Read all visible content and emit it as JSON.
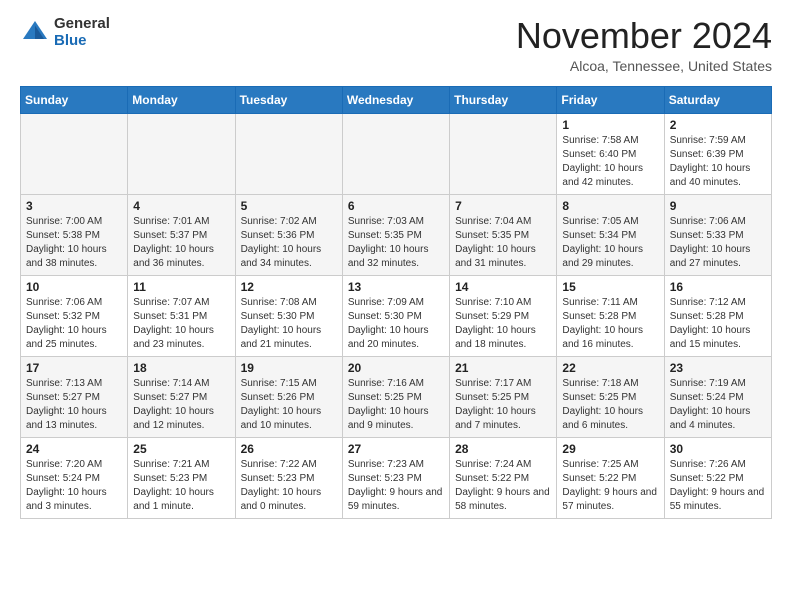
{
  "header": {
    "logo_general": "General",
    "logo_blue": "Blue",
    "month_title": "November 2024",
    "location": "Alcoa, Tennessee, United States"
  },
  "calendar": {
    "days_of_week": [
      "Sunday",
      "Monday",
      "Tuesday",
      "Wednesday",
      "Thursday",
      "Friday",
      "Saturday"
    ],
    "weeks": [
      [
        {
          "day": "",
          "info": ""
        },
        {
          "day": "",
          "info": ""
        },
        {
          "day": "",
          "info": ""
        },
        {
          "day": "",
          "info": ""
        },
        {
          "day": "",
          "info": ""
        },
        {
          "day": "1",
          "info": "Sunrise: 7:58 AM\nSunset: 6:40 PM\nDaylight: 10 hours and 42 minutes."
        },
        {
          "day": "2",
          "info": "Sunrise: 7:59 AM\nSunset: 6:39 PM\nDaylight: 10 hours and 40 minutes."
        }
      ],
      [
        {
          "day": "3",
          "info": "Sunrise: 7:00 AM\nSunset: 5:38 PM\nDaylight: 10 hours and 38 minutes."
        },
        {
          "day": "4",
          "info": "Sunrise: 7:01 AM\nSunset: 5:37 PM\nDaylight: 10 hours and 36 minutes."
        },
        {
          "day": "5",
          "info": "Sunrise: 7:02 AM\nSunset: 5:36 PM\nDaylight: 10 hours and 34 minutes."
        },
        {
          "day": "6",
          "info": "Sunrise: 7:03 AM\nSunset: 5:35 PM\nDaylight: 10 hours and 32 minutes."
        },
        {
          "day": "7",
          "info": "Sunrise: 7:04 AM\nSunset: 5:35 PM\nDaylight: 10 hours and 31 minutes."
        },
        {
          "day": "8",
          "info": "Sunrise: 7:05 AM\nSunset: 5:34 PM\nDaylight: 10 hours and 29 minutes."
        },
        {
          "day": "9",
          "info": "Sunrise: 7:06 AM\nSunset: 5:33 PM\nDaylight: 10 hours and 27 minutes."
        }
      ],
      [
        {
          "day": "10",
          "info": "Sunrise: 7:06 AM\nSunset: 5:32 PM\nDaylight: 10 hours and 25 minutes."
        },
        {
          "day": "11",
          "info": "Sunrise: 7:07 AM\nSunset: 5:31 PM\nDaylight: 10 hours and 23 minutes."
        },
        {
          "day": "12",
          "info": "Sunrise: 7:08 AM\nSunset: 5:30 PM\nDaylight: 10 hours and 21 minutes."
        },
        {
          "day": "13",
          "info": "Sunrise: 7:09 AM\nSunset: 5:30 PM\nDaylight: 10 hours and 20 minutes."
        },
        {
          "day": "14",
          "info": "Sunrise: 7:10 AM\nSunset: 5:29 PM\nDaylight: 10 hours and 18 minutes."
        },
        {
          "day": "15",
          "info": "Sunrise: 7:11 AM\nSunset: 5:28 PM\nDaylight: 10 hours and 16 minutes."
        },
        {
          "day": "16",
          "info": "Sunrise: 7:12 AM\nSunset: 5:28 PM\nDaylight: 10 hours and 15 minutes."
        }
      ],
      [
        {
          "day": "17",
          "info": "Sunrise: 7:13 AM\nSunset: 5:27 PM\nDaylight: 10 hours and 13 minutes."
        },
        {
          "day": "18",
          "info": "Sunrise: 7:14 AM\nSunset: 5:27 PM\nDaylight: 10 hours and 12 minutes."
        },
        {
          "day": "19",
          "info": "Sunrise: 7:15 AM\nSunset: 5:26 PM\nDaylight: 10 hours and 10 minutes."
        },
        {
          "day": "20",
          "info": "Sunrise: 7:16 AM\nSunset: 5:25 PM\nDaylight: 10 hours and 9 minutes."
        },
        {
          "day": "21",
          "info": "Sunrise: 7:17 AM\nSunset: 5:25 PM\nDaylight: 10 hours and 7 minutes."
        },
        {
          "day": "22",
          "info": "Sunrise: 7:18 AM\nSunset: 5:25 PM\nDaylight: 10 hours and 6 minutes."
        },
        {
          "day": "23",
          "info": "Sunrise: 7:19 AM\nSunset: 5:24 PM\nDaylight: 10 hours and 4 minutes."
        }
      ],
      [
        {
          "day": "24",
          "info": "Sunrise: 7:20 AM\nSunset: 5:24 PM\nDaylight: 10 hours and 3 minutes."
        },
        {
          "day": "25",
          "info": "Sunrise: 7:21 AM\nSunset: 5:23 PM\nDaylight: 10 hours and 1 minute."
        },
        {
          "day": "26",
          "info": "Sunrise: 7:22 AM\nSunset: 5:23 PM\nDaylight: 10 hours and 0 minutes."
        },
        {
          "day": "27",
          "info": "Sunrise: 7:23 AM\nSunset: 5:23 PM\nDaylight: 9 hours and 59 minutes."
        },
        {
          "day": "28",
          "info": "Sunrise: 7:24 AM\nSunset: 5:22 PM\nDaylight: 9 hours and 58 minutes."
        },
        {
          "day": "29",
          "info": "Sunrise: 7:25 AM\nSunset: 5:22 PM\nDaylight: 9 hours and 57 minutes."
        },
        {
          "day": "30",
          "info": "Sunrise: 7:26 AM\nSunset: 5:22 PM\nDaylight: 9 hours and 55 minutes."
        }
      ]
    ]
  }
}
